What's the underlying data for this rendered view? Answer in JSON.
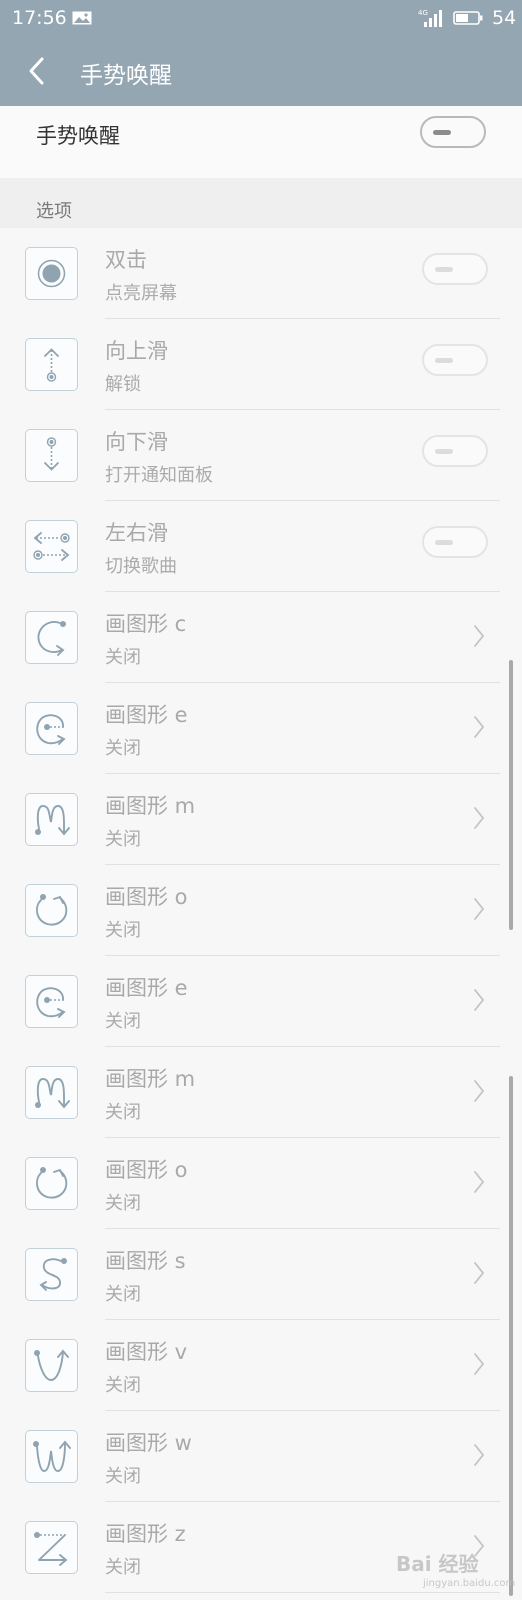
{
  "status": {
    "time": "17:56",
    "network": "4G",
    "battery": "54"
  },
  "header": {
    "title": "手势唤醒"
  },
  "master": {
    "label": "手势唤醒",
    "enabled": false
  },
  "section": {
    "label": "选项"
  },
  "rows": [
    {
      "title": "双击",
      "subtitle": "点亮屏幕",
      "icon": "double-tap-icon",
      "control": "toggle"
    },
    {
      "title": "向上滑",
      "subtitle": "解锁",
      "icon": "swipe-up-icon",
      "control": "toggle"
    },
    {
      "title": "向下滑",
      "subtitle": "打开通知面板",
      "icon": "swipe-down-icon",
      "control": "toggle"
    },
    {
      "title": "左右滑",
      "subtitle": "切换歌曲",
      "icon": "swipe-left-right-icon",
      "control": "toggle"
    },
    {
      "title": "画图形 c",
      "subtitle": "关闭",
      "icon": "draw-c-icon",
      "control": "chevron"
    },
    {
      "title": "画图形 e",
      "subtitle": "关闭",
      "icon": "draw-e-icon",
      "control": "chevron"
    },
    {
      "title": "画图形 m",
      "subtitle": "关闭",
      "icon": "draw-m-icon",
      "control": "chevron"
    },
    {
      "title": "画图形 o",
      "subtitle": "关闭",
      "icon": "draw-o-icon",
      "control": "chevron"
    },
    {
      "title": "画图形 e",
      "subtitle": "关闭",
      "icon": "draw-e-icon",
      "control": "chevron"
    },
    {
      "title": "画图形 m",
      "subtitle": "关闭",
      "icon": "draw-m-icon",
      "control": "chevron"
    },
    {
      "title": "画图形 o",
      "subtitle": "关闭",
      "icon": "draw-o-icon",
      "control": "chevron"
    },
    {
      "title": "画图形 s",
      "subtitle": "关闭",
      "icon": "draw-s-icon",
      "control": "chevron"
    },
    {
      "title": "画图形 v",
      "subtitle": "关闭",
      "icon": "draw-v-icon",
      "control": "chevron"
    },
    {
      "title": "画图形 w",
      "subtitle": "关闭",
      "icon": "draw-w-icon",
      "control": "chevron"
    },
    {
      "title": "画图形 z",
      "subtitle": "关闭",
      "icon": "draw-z-icon",
      "control": "chevron"
    }
  ],
  "watermark": {
    "brand": "Bai 经验",
    "url": "jingyan.baidu.com"
  },
  "colors": {
    "bar": "#93a6b1",
    "icon": "#8fa3b0",
    "background": "#f7f7f7"
  }
}
